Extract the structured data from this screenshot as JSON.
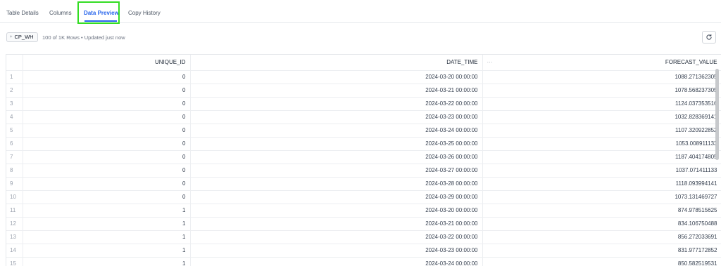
{
  "tabs": [
    {
      "label": "Table Details"
    },
    {
      "label": "Columns"
    },
    {
      "label": "Data Preview"
    },
    {
      "label": "Copy History"
    }
  ],
  "toolbar": {
    "warehouse": "CP_WH",
    "rows_info": "100 of 1K Rows • Updated just now"
  },
  "table": {
    "columns": [
      "UNIQUE_ID",
      "DATE_TIME",
      "FORECAST_VALUE"
    ],
    "column_menu": "···",
    "rows": [
      [
        "1",
        "0",
        "2024-03-20 00:00:00",
        "1088.271362305"
      ],
      [
        "2",
        "0",
        "2024-03-21 00:00:00",
        "1078.568237305"
      ],
      [
        "3",
        "0",
        "2024-03-22 00:00:00",
        "1124.037353516"
      ],
      [
        "4",
        "0",
        "2024-03-23 00:00:00",
        "1032.828369141"
      ],
      [
        "5",
        "0",
        "2024-03-24 00:00:00",
        "1107.320922852"
      ],
      [
        "6",
        "0",
        "2024-03-25 00:00:00",
        "1053.008911133"
      ],
      [
        "7",
        "0",
        "2024-03-26 00:00:00",
        "1187.404174805"
      ],
      [
        "8",
        "0",
        "2024-03-27 00:00:00",
        "1037.071411133"
      ],
      [
        "9",
        "0",
        "2024-03-28 00:00:00",
        "1118.093994141"
      ],
      [
        "10",
        "0",
        "2024-03-29 00:00:00",
        "1073.131469727"
      ],
      [
        "11",
        "1",
        "2024-03-20 00:00:00",
        "874.978515625"
      ],
      [
        "12",
        "1",
        "2024-03-21 00:00:00",
        "834.106750488"
      ],
      [
        "13",
        "1",
        "2024-03-22 00:00:00",
        "856.272033691"
      ],
      [
        "14",
        "1",
        "2024-03-23 00:00:00",
        "831.977172852"
      ],
      [
        "15",
        "1",
        "2024-03-24 00:00:00",
        "850.582519531"
      ]
    ]
  },
  "colors": {
    "accent": "#2563eb",
    "highlight": "#33dd22"
  }
}
